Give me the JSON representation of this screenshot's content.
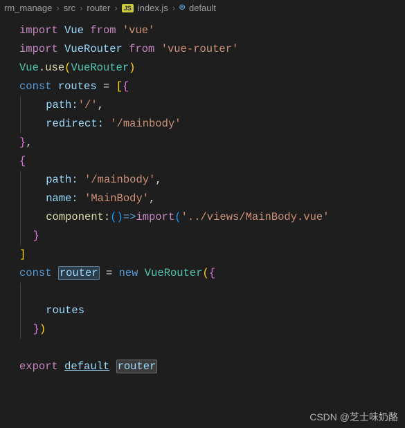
{
  "breadcrumb": {
    "items": [
      "rm_manage",
      "src",
      "router",
      "index.js",
      "default"
    ],
    "sep": "›",
    "js_badge": "JS",
    "sym_badge": "⌾"
  },
  "code": {
    "l1": {
      "a": "import",
      "b": "Vue",
      "c": "from",
      "d": "'vue'"
    },
    "l2": {
      "a": "import",
      "b": "VueRouter",
      "c": "from",
      "d": "'vue-router'"
    },
    "l3": {
      "a": "Vue",
      "b": ".",
      "c": "use",
      "d": "(",
      "e": "VueRouter",
      "f": ")"
    },
    "l4": {
      "a": "const",
      "b": "routes",
      "c": "=",
      "d": "[",
      "e": "{"
    },
    "l5": {
      "a": "path:",
      "b": "'/'",
      "c": ","
    },
    "l6": {
      "a": "redirect:",
      "b": "'/mainbody'"
    },
    "l7": {
      "a": "}",
      "b": ","
    },
    "l8": {
      "a": "{"
    },
    "l9": {
      "a": "path:",
      "b": "'/mainbody'",
      "c": ","
    },
    "l10": {
      "a": "name:",
      "b": "'MainBody'",
      "c": ","
    },
    "l11": {
      "a": "component:",
      "b": "(",
      "c": ")",
      "d": "=>",
      "e": "import",
      "f": "(",
      "g": "'../views/MainBody.vue'"
    },
    "l12": {
      "a": "}"
    },
    "l13": {
      "a": "]"
    },
    "l14": {
      "a": "const",
      "b": "router",
      "c": "=",
      "d": "new",
      "e": "VueRouter",
      "f": "(",
      "g": "{"
    },
    "l15": {
      "a": "routes"
    },
    "l16": {
      "a": "}",
      "b": ")"
    },
    "l17": {
      "a": "export",
      "b": "default",
      "c": "router"
    }
  },
  "watermark": "CSDN @芝士味奶酪"
}
